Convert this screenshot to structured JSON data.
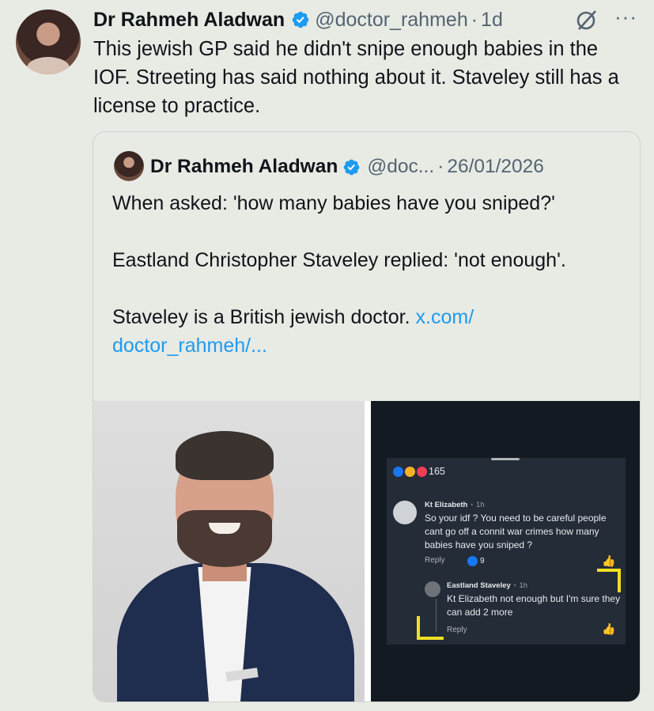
{
  "tweet": {
    "author_name": "Dr Rahmeh Aladwan",
    "handle": "@doctor_rahmeh",
    "time": "1d",
    "text": "This jewish GP said he didn't snipe enough babies in the IOF. Streeting has said nothing about it. Staveley still has a license to practice."
  },
  "quote": {
    "author_name": "Dr Rahmeh Aladwan",
    "handle": "@doc...",
    "date": "26/01/2026",
    "paragraph1": "When asked: 'how many babies have you sniped?'",
    "paragraph2": "Eastland Christopher Staveley replied: 'not enough'.",
    "paragraph3": "Staveley is a British jewish doctor.",
    "link1": "x.com/",
    "link2": "doctor_rahmeh/..."
  },
  "fb_comment": {
    "reaction_count": "165",
    "comment1_author": "Kt Elizabeth",
    "comment1_time": "1h",
    "comment1_text": "So your idf ? You need to be careful people cant go off a connit war crimes how many babies have you sniped ?",
    "comment1_reply": "Reply",
    "comment1_likes": "9",
    "comment2_author": "Eastland Staveley",
    "comment2_time": "1h",
    "comment2_text": "Kt Elizabeth not enough but I'm sure they can add 2 more",
    "comment2_reply": "Reply"
  },
  "colors": {
    "background": "#e8eae4",
    "verified": "#1d9bf0",
    "link": "#1d9bf0",
    "highlight": "#f0e020"
  },
  "icons": [
    "verified-badge-icon",
    "grok-icon",
    "more-icon",
    "thumbs-up-icon"
  ]
}
